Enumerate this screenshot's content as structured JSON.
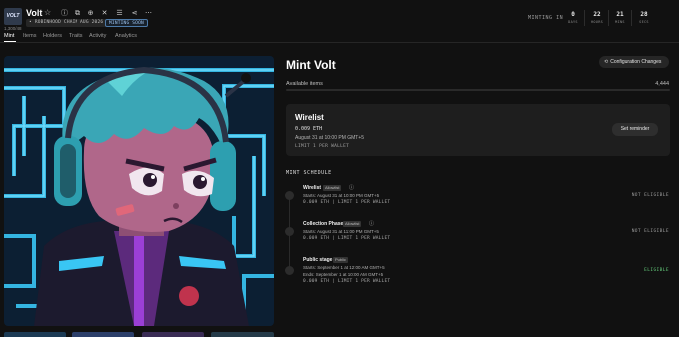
{
  "collection": {
    "logo_text": "VOLT",
    "logo_sub": "1,300/48",
    "name": "Volt",
    "chips": [
      "• ROBINHOOD CHAIN",
      "AUG 2026",
      "MINTING SOON"
    ]
  },
  "header_icons": [
    "star-icon",
    "info-icon",
    "copy-icon",
    "globe-icon",
    "x-icon",
    "discord-icon",
    "share-icon",
    "more-icon"
  ],
  "countdown": {
    "label": "MINTING IN",
    "units": [
      {
        "value": "0",
        "unit": "DAYS"
      },
      {
        "value": "22",
        "unit": "HOURS"
      },
      {
        "value": "21",
        "unit": "MINS"
      },
      {
        "value": "28",
        "unit": "SECS"
      }
    ]
  },
  "tabs": [
    "Mint",
    "Items",
    "Holders",
    "Traits",
    "Activity",
    "Analytics"
  ],
  "main": {
    "title": "Mint Volt",
    "config_button": "Configuration Changes",
    "available_label": "Available items",
    "available_value": "4,444"
  },
  "active_stage": {
    "name": "Wirelist",
    "price": "0.009 ETH",
    "date": "August 31 at 10:00 PM GMT+5",
    "limit": "LIMIT 1 PER WALLET",
    "reminder_button": "Set reminder"
  },
  "schedule": {
    "heading": "MINT SCHEDULE",
    "phases": [
      {
        "name": "Wirelist",
        "badge": "Allowlist",
        "lines": [
          "Starts: August 31 at 10:00 PM GMT+5"
        ],
        "price": "0.009 ETH | LIMIT 1 PER WALLET",
        "status": "NOT ELIGIBLE",
        "eligible": false
      },
      {
        "name": "Collection Phase",
        "badge": "Allowlist",
        "lines": [
          "Starts: August 31 at 11:00 PM GMT+5"
        ],
        "price": "0.009 ETH | LIMIT 1 PER WALLET",
        "status": "NOT ELIGIBLE",
        "eligible": false
      },
      {
        "name": "Public stage",
        "badge": "Public",
        "lines": [
          "Starts: September 1 at 12:00 AM GMT+5",
          "Ends: September 1 at 10:00 AM GMT+5"
        ],
        "price": "0.009 ETH | LIMIT 1 PER WALLET",
        "status": "ELIGIBLE",
        "eligible": true
      }
    ]
  },
  "colors": {
    "background": "#111111",
    "card": "#1e1e1e",
    "eligible": "#63c97a",
    "hero_blue": "#39c6f4",
    "hero_hair": "#3aa6b6",
    "hero_skin": "#b0678a"
  }
}
